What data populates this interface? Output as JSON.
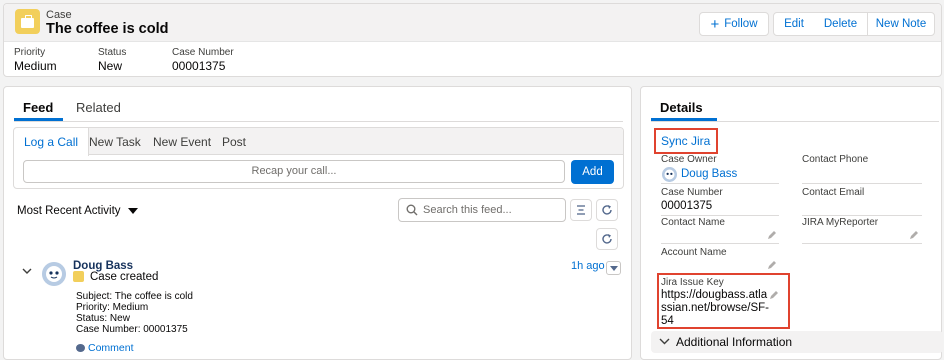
{
  "header": {
    "object_label": "Case",
    "title": "The coffee is cold",
    "buttons": {
      "follow": "Follow",
      "edit": "Edit",
      "delete": "Delete",
      "new_note": "New Note"
    },
    "fields": [
      {
        "label": "Priority",
        "value": "Medium"
      },
      {
        "label": "Status",
        "value": "New"
      },
      {
        "label": "Case Number",
        "value": "00001375"
      }
    ]
  },
  "feed": {
    "tabs": {
      "feed": "Feed",
      "related": "Related"
    },
    "publisher": {
      "tabs": [
        "Log a Call",
        "New Task",
        "New Event",
        "Post"
      ],
      "input_placeholder": "Recap your call...",
      "add_label": "Add"
    },
    "sort_label": "Most Recent Activity",
    "search_placeholder": "Search this feed...",
    "item": {
      "author": "Doug Bass",
      "action": "Case created",
      "timestamp": "1h ago",
      "details": [
        "Subject: The coffee is cold",
        "Priority: Medium",
        "Status: New",
        "Case Number: 00001375"
      ],
      "comment_label": "Comment"
    }
  },
  "details": {
    "tab": "Details",
    "sync_jira": "Sync Jira",
    "case_owner_label": "Case Owner",
    "case_owner_value": "Doug Bass",
    "contact_phone_label": "Contact Phone",
    "case_number_label": "Case Number",
    "case_number_value": "00001375",
    "contact_email_label": "Contact Email",
    "contact_name_label": "Contact Name",
    "jira_myreporter_label": "JIRA MyReporter",
    "account_name_label": "Account Name",
    "jira_issue_key_label": "Jira Issue Key",
    "jira_issue_key_value": [
      "https://dougbass.atla",
      "ssian.net/browse/SF-",
      "54"
    ],
    "additional_info": "Additional Information"
  },
  "colors": {
    "accent": "#0070d2",
    "highlight": "#e0432f",
    "case_icon": "#f2cf5b"
  }
}
